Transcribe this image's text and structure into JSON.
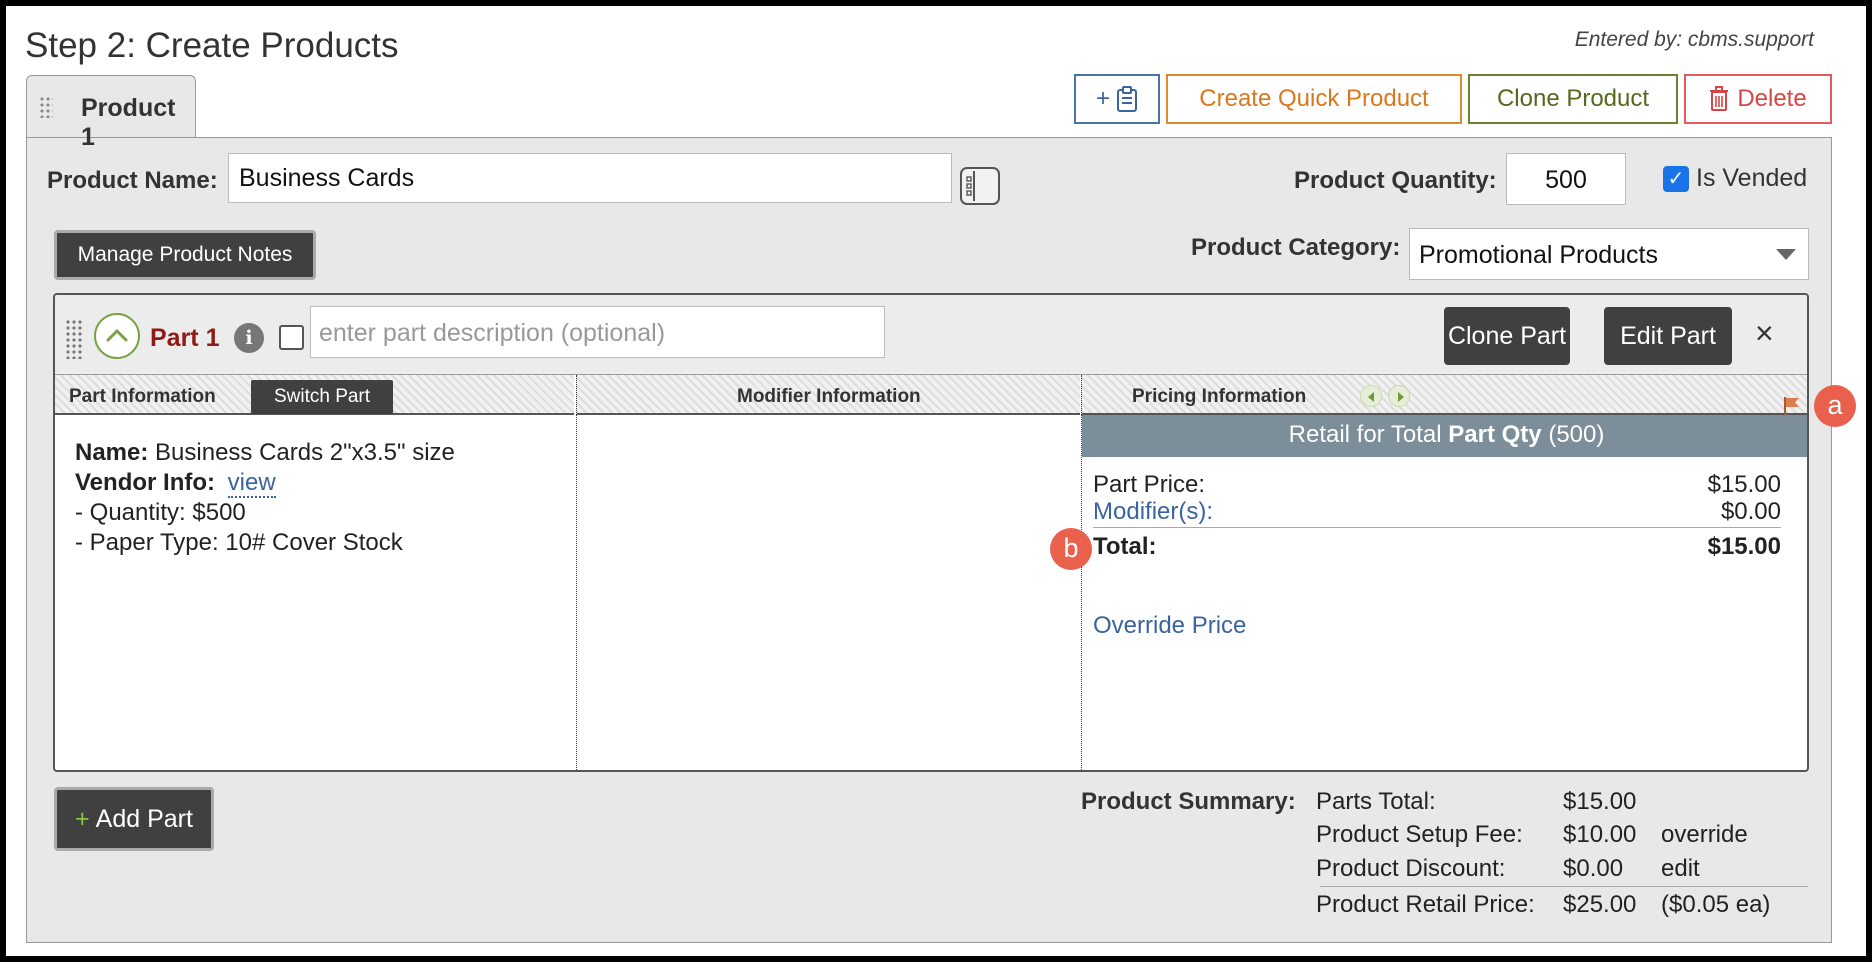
{
  "header": {
    "step_title": "Step 2: Create Products",
    "entered_by": "Entered by: cbms.support"
  },
  "product_tab": {
    "label": "Product 1"
  },
  "toolbar": {
    "clipboard_button": "+",
    "quick_product": "Create Quick Product",
    "clone_product": "Clone Product",
    "delete": "Delete"
  },
  "product": {
    "name_label": "Product Name:",
    "name_value": "Business Cards",
    "quantity_label": "Product Quantity:",
    "quantity_value": "500",
    "is_vended_label": "Is Vended",
    "is_vended_checked": true,
    "notes_button": "Manage Product Notes",
    "category_label": "Product Category:",
    "category_value": "Promotional Products"
  },
  "part": {
    "title": "Part 1",
    "info_glyph": "i",
    "description_placeholder": "enter part description (optional)",
    "clone_button": "Clone Part",
    "edit_button": "Edit Part",
    "close_glyph": "×",
    "columns": {
      "part_info": "Part Information",
      "switch_button": "Switch Part",
      "modifier_info": "Modifier Information",
      "pricing_info": "Pricing Information"
    },
    "details": {
      "name_label": "Name:",
      "name_value": "Business Cards 2\"x3.5\" size",
      "vendor_label": "Vendor Info:",
      "vendor_link": "view",
      "quantity": "- Quantity: $500",
      "paper_type": "- Paper Type: 10# Cover Stock"
    },
    "pricing": {
      "header_prefix": "Retail for Total",
      "header_bold": "Part Qty",
      "header_suffix": "(500)",
      "part_price_label": "Part Price:",
      "part_price_value": "$15.00",
      "modifiers_label": "Modifier(s):",
      "modifiers_value": "$0.00",
      "total_label": "Total:",
      "total_value": "$15.00",
      "override_link": "Override Price"
    }
  },
  "add_part": {
    "plus": "+",
    "label": "Add Part"
  },
  "summary": {
    "label": "Product Summary:",
    "rows": [
      {
        "label": "Parts Total:",
        "value": "$15.00",
        "extra": ""
      },
      {
        "label": "Product Setup Fee:",
        "value": "$10.00",
        "extra": "override"
      },
      {
        "label": "Product Discount:",
        "value": "$0.00",
        "extra": "edit"
      },
      {
        "label": "Product Retail Price:",
        "value": "$25.00",
        "extra": "($0.05 ea)"
      }
    ]
  },
  "markers": {
    "a": "a",
    "b": "b"
  },
  "colors": {
    "part_title": "#8e1a1a",
    "link": "#3a64a0",
    "quick_product": "#d9781c",
    "clone_product": "#55681e",
    "delete": "#d84545",
    "retail_bar": "#7b8e99",
    "marker": "#e9604d"
  },
  "icons": {
    "clipboard": "clipboard-icon",
    "trash": "trash-icon",
    "layout": "layout-icon",
    "collapse": "chevron-up-icon",
    "flag": "flag-icon"
  }
}
